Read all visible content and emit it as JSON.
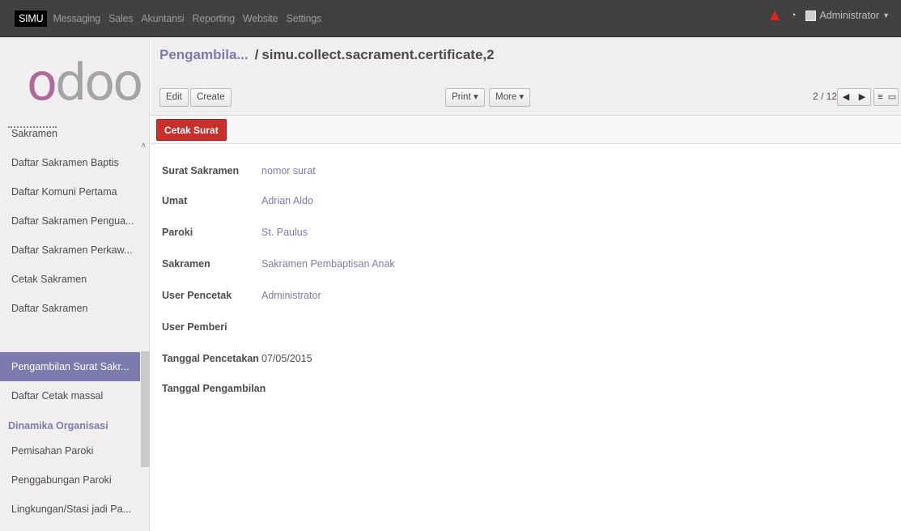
{
  "topbar": {
    "menus": [
      "SIMU",
      "Messaging",
      "Sales",
      "Akuntansi",
      "Reporting",
      "Website",
      "Settings"
    ],
    "user": "Administrator"
  },
  "sidebar": {
    "logo": "odoo",
    "items": [
      "Sakramen",
      "Daftar Sakramen Baptis",
      "Daftar Komuni Pertama",
      "Daftar Sakramen Pengua...",
      "Daftar Sakramen Perkaw...",
      "Cetak Sakramen",
      "Daftar Sakramen",
      "Pengambilan Surat Sakr...",
      "Daftar Cetak massal"
    ],
    "section": "Dinamika Organisasi",
    "section_items": [
      "Pemisahan Paroki",
      "Penggabungan Paroki",
      "Lingkungan/Stasi jadi Pa..."
    ]
  },
  "header": {
    "breadcrumb_link": "Pengambila...",
    "breadcrumb_sep": "/",
    "breadcrumb_current": "simu.collect.sacrament.certificate,2",
    "edit": "Edit",
    "create": "Create",
    "print": "Print ▾",
    "more": "More ▾",
    "pager": "2 / 12"
  },
  "statusbar": {
    "action": "Cetak Surat"
  },
  "form": {
    "fields": [
      {
        "label": "Surat Sakramen",
        "value": "nomor surat"
      },
      {
        "label": "Umat",
        "value": "Adrian Aldo"
      },
      {
        "label": "Paroki",
        "value": "St. Paulus"
      },
      {
        "label": "Sakramen",
        "value": "Sakramen Pembaptisan Anak"
      },
      {
        "label": "User Pencetak",
        "value": "Administrator"
      },
      {
        "label": "User Pemberi",
        "value": ""
      },
      {
        "label": "Tanggal Pencetakan",
        "value": "07/05/2015"
      },
      {
        "label": "Tanggal Pengambilan",
        "value": ""
      }
    ]
  },
  "colors": {
    "brand": "#7c7bad",
    "primary_button": "#c7302b",
    "topbar": "#414141"
  }
}
